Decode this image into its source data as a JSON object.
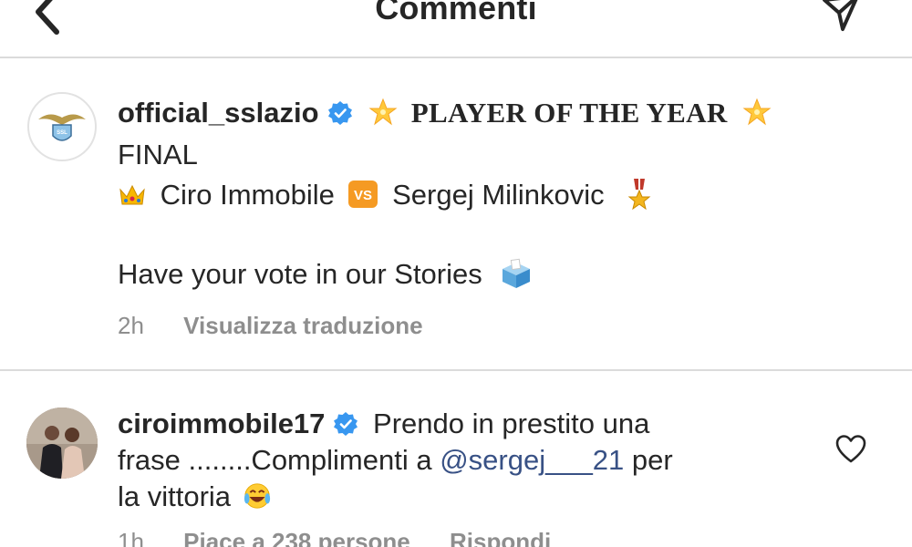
{
  "header": {
    "title": "Commenti",
    "back_icon": "back-arrow-icon",
    "share_icon": "direct-send-icon"
  },
  "caption": {
    "username": "official_sslazio",
    "title_text": "PLAYER OF THE YEAR",
    "line2": "FINAL",
    "player1": "Ciro Immobile",
    "vs_label": "VS",
    "player2": "Sergej Milinkovic",
    "line4": "Have your vote in our Stories",
    "time": "2h",
    "translate_label": "Visualizza traduzione"
  },
  "comment": {
    "username": "ciroimmobile17",
    "text_1": "Prendo in prestito una",
    "text_2": "frase ........Complimenti a",
    "mention": "@sergej___21",
    "text_3": " per",
    "text_4": "la vittoria",
    "time": "1h",
    "likes_label": "Piace a 238 persone",
    "reply_label": "Rispondi"
  },
  "colors": {
    "text": "#262626",
    "secondary": "#8e8e8e",
    "divider": "#dbdbdb",
    "mention": "#385185",
    "verified": "#3897f0"
  }
}
